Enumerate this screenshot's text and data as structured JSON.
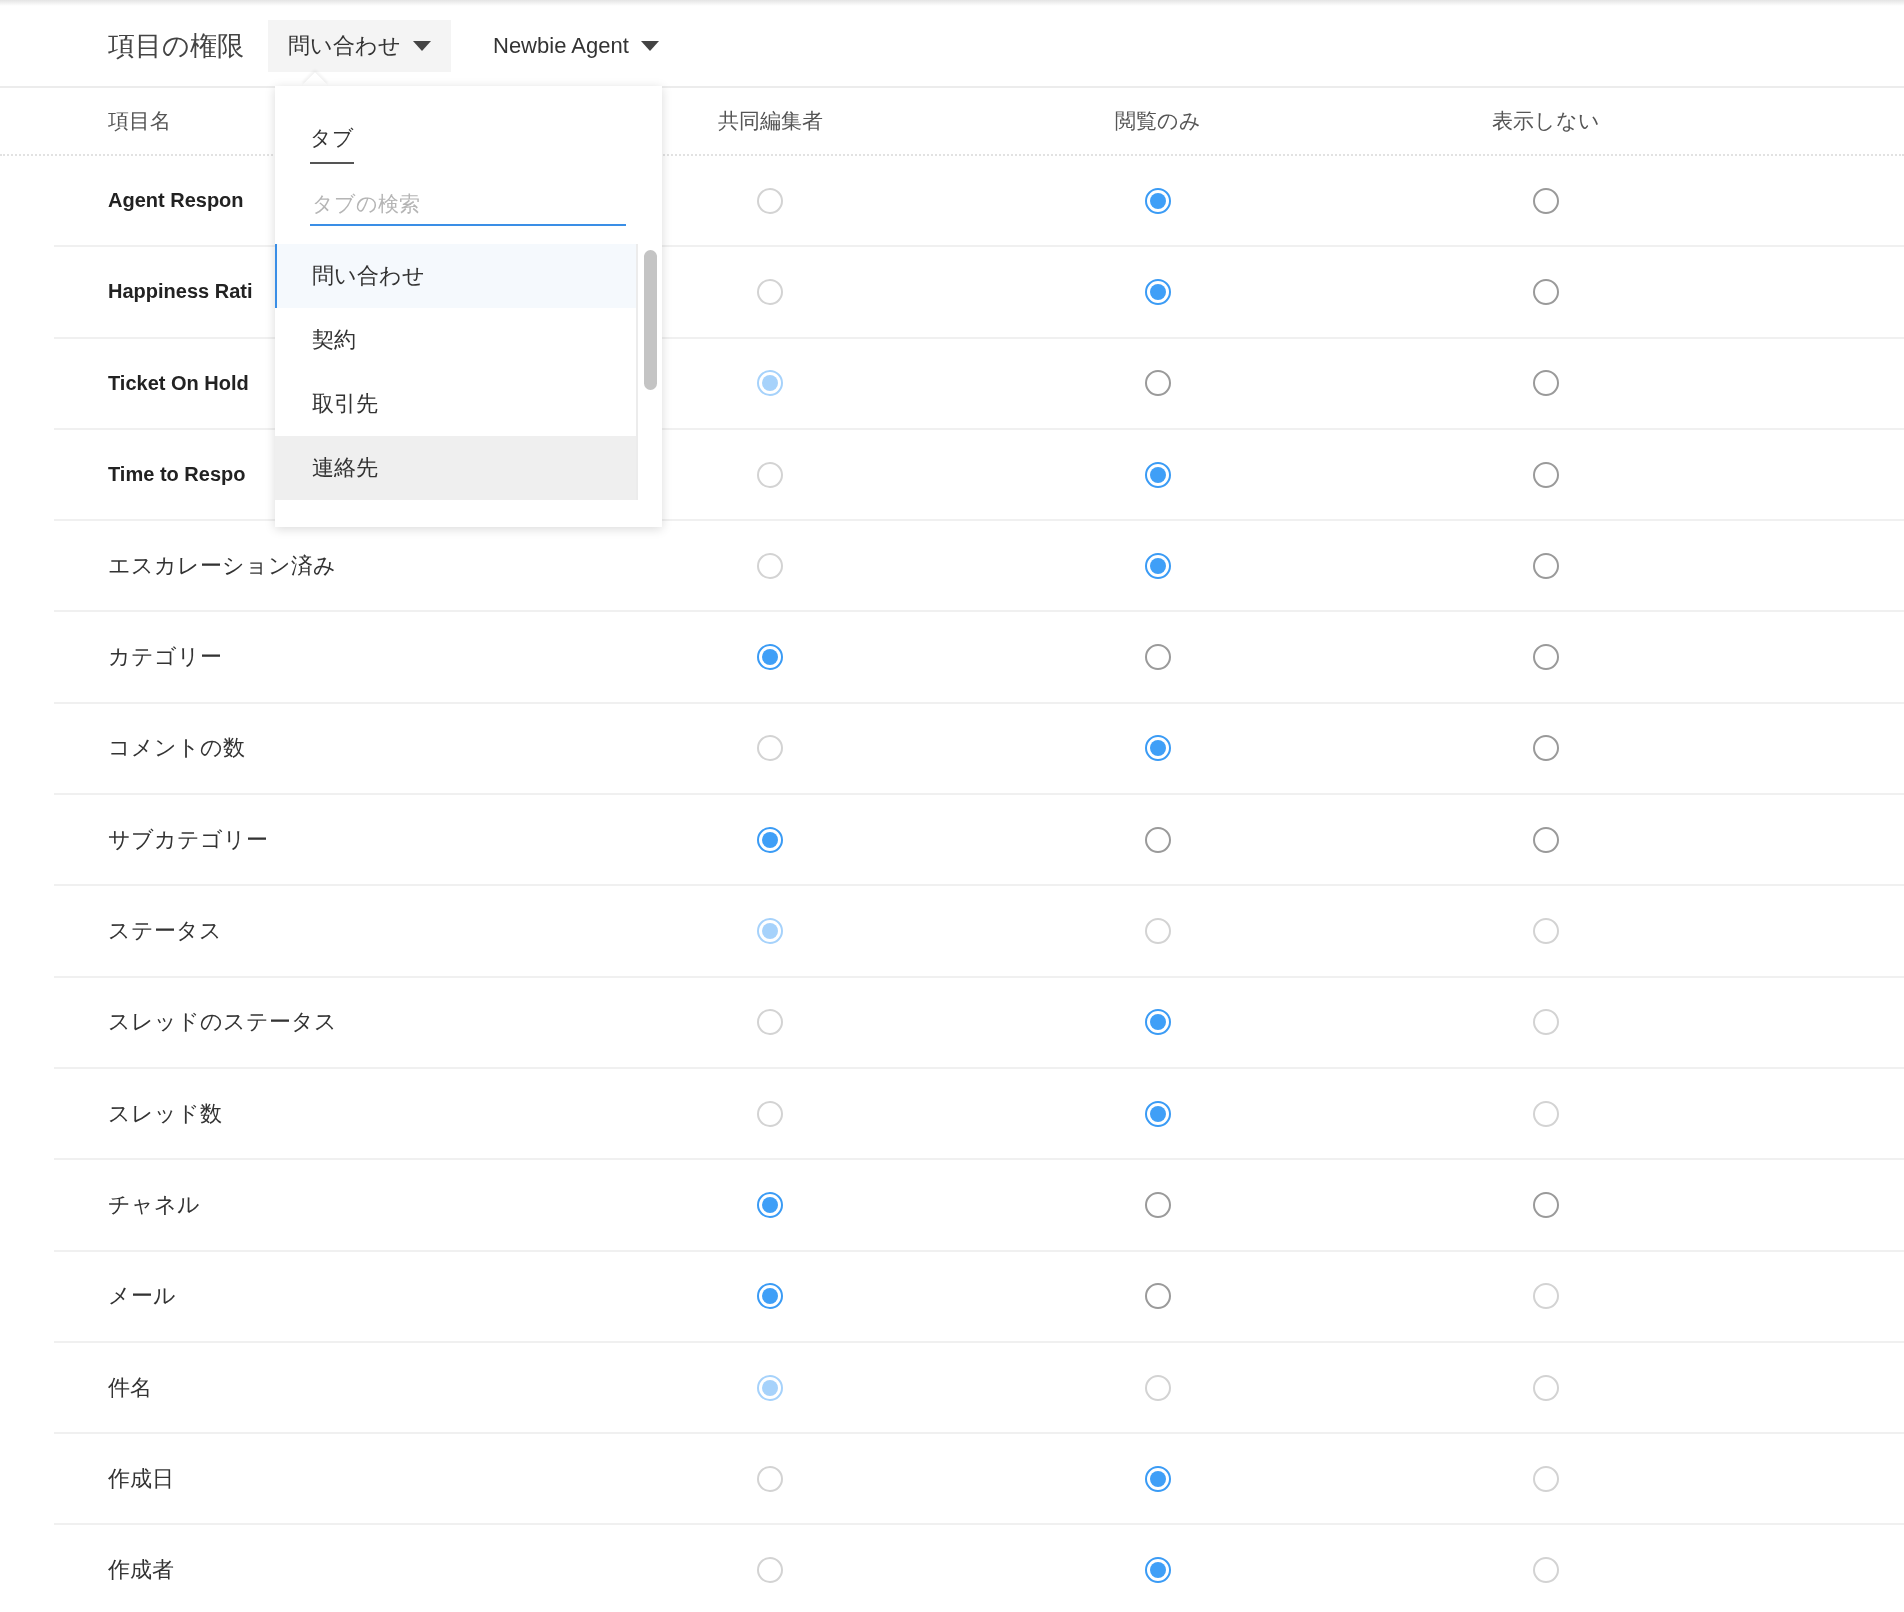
{
  "header": {
    "title": "項目の権限",
    "tab_selector": {
      "label": "問い合わせ",
      "expanded": true
    },
    "profile_selector": {
      "label": "Newbie Agent"
    }
  },
  "columns": [
    "項目名",
    "共同編集者",
    "閲覧のみ",
    "表示しない"
  ],
  "rows": [
    {
      "name": "Agent Respon",
      "bold": true,
      "options": [
        {
          "selected": false,
          "disabled": true
        },
        {
          "selected": true,
          "disabled": false
        },
        {
          "selected": false,
          "disabled": false
        }
      ]
    },
    {
      "name": "Happiness Rati",
      "bold": true,
      "options": [
        {
          "selected": false,
          "disabled": true
        },
        {
          "selected": true,
          "disabled": false
        },
        {
          "selected": false,
          "disabled": false
        }
      ]
    },
    {
      "name": "Ticket On Hold",
      "bold": true,
      "options": [
        {
          "selected": true,
          "disabled": true
        },
        {
          "selected": false,
          "disabled": false
        },
        {
          "selected": false,
          "disabled": false
        }
      ]
    },
    {
      "name": "Time to Respo",
      "bold": true,
      "options": [
        {
          "selected": false,
          "disabled": true
        },
        {
          "selected": true,
          "disabled": false
        },
        {
          "selected": false,
          "disabled": false
        }
      ]
    },
    {
      "name": "エスカレーション済み",
      "bold": false,
      "options": [
        {
          "selected": false,
          "disabled": true
        },
        {
          "selected": true,
          "disabled": false
        },
        {
          "selected": false,
          "disabled": false
        }
      ]
    },
    {
      "name": "カテゴリー",
      "bold": false,
      "options": [
        {
          "selected": true,
          "disabled": false
        },
        {
          "selected": false,
          "disabled": false
        },
        {
          "selected": false,
          "disabled": false
        }
      ]
    },
    {
      "name": "コメントの数",
      "bold": false,
      "options": [
        {
          "selected": false,
          "disabled": true
        },
        {
          "selected": true,
          "disabled": false
        },
        {
          "selected": false,
          "disabled": false
        }
      ]
    },
    {
      "name": "サブカテゴリー",
      "bold": false,
      "options": [
        {
          "selected": true,
          "disabled": false
        },
        {
          "selected": false,
          "disabled": false
        },
        {
          "selected": false,
          "disabled": false
        }
      ]
    },
    {
      "name": "ステータス",
      "bold": false,
      "options": [
        {
          "selected": true,
          "disabled": true
        },
        {
          "selected": false,
          "disabled": true
        },
        {
          "selected": false,
          "disabled": true
        }
      ]
    },
    {
      "name": "スレッドのステータス",
      "bold": false,
      "options": [
        {
          "selected": false,
          "disabled": true
        },
        {
          "selected": true,
          "disabled": false
        },
        {
          "selected": false,
          "disabled": true
        }
      ]
    },
    {
      "name": "スレッド数",
      "bold": false,
      "options": [
        {
          "selected": false,
          "disabled": true
        },
        {
          "selected": true,
          "disabled": false
        },
        {
          "selected": false,
          "disabled": true
        }
      ]
    },
    {
      "name": "チャネル",
      "bold": false,
      "options": [
        {
          "selected": true,
          "disabled": false
        },
        {
          "selected": false,
          "disabled": false
        },
        {
          "selected": false,
          "disabled": false
        }
      ]
    },
    {
      "name": "メール",
      "bold": false,
      "options": [
        {
          "selected": true,
          "disabled": false
        },
        {
          "selected": false,
          "disabled": false
        },
        {
          "selected": false,
          "disabled": true
        }
      ]
    },
    {
      "name": "件名",
      "bold": false,
      "options": [
        {
          "selected": true,
          "disabled": true
        },
        {
          "selected": false,
          "disabled": true
        },
        {
          "selected": false,
          "disabled": true
        }
      ]
    },
    {
      "name": "作成日",
      "bold": false,
      "options": [
        {
          "selected": false,
          "disabled": true
        },
        {
          "selected": true,
          "disabled": false
        },
        {
          "selected": false,
          "disabled": true
        }
      ]
    },
    {
      "name": "作成者",
      "bold": false,
      "options": [
        {
          "selected": false,
          "disabled": true
        },
        {
          "selected": true,
          "disabled": false
        },
        {
          "selected": false,
          "disabled": true
        }
      ]
    }
  ],
  "dropdown": {
    "label": "タブ",
    "search": {
      "placeholder": "タブの検索"
    },
    "items": [
      {
        "label": "問い合わせ",
        "selected": true,
        "highlighted": false
      },
      {
        "label": "契約",
        "selected": false,
        "highlighted": false
      },
      {
        "label": "取引先",
        "selected": false,
        "highlighted": false
      },
      {
        "label": "連絡先",
        "selected": false,
        "highlighted": true
      }
    ]
  }
}
